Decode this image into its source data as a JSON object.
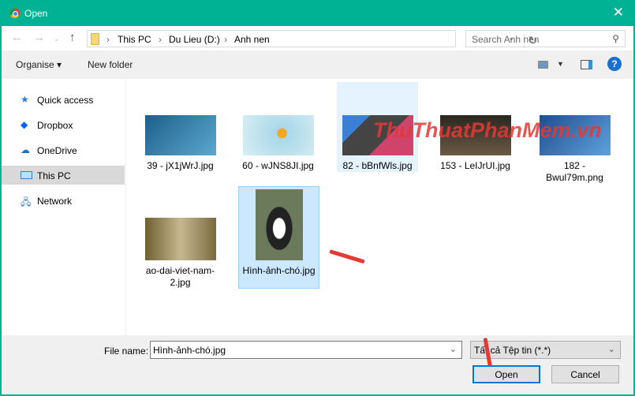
{
  "title": "Open",
  "breadcrumb": [
    "This PC",
    "Du Lieu (D:)",
    "Anh nen"
  ],
  "search_placeholder": "Search Anh nen",
  "toolbar": {
    "organise": "Organise ▾",
    "new_folder": "New folder"
  },
  "sidebar": [
    {
      "label": "Quick access",
      "icon": "star-icon"
    },
    {
      "label": "Dropbox",
      "icon": "dropbox-icon"
    },
    {
      "label": "OneDrive",
      "icon": "cloud-icon"
    },
    {
      "label": "This PC",
      "icon": "computer-icon",
      "selected": true
    },
    {
      "label": "Network",
      "icon": "network-icon"
    }
  ],
  "files": [
    {
      "name": "39 - jX1jWrJ.jpg",
      "color": "#2a6f9a"
    },
    {
      "name": "60 - wJNS8JI.jpg",
      "color": "#9fcfe0"
    },
    {
      "name": "82 - bBnfWls.jpg",
      "color": "#555"
    },
    {
      "name": "153 - LeIJrUI.jpg",
      "color": "#3a3026"
    },
    {
      "name": "182 - Bwul79m.png",
      "color": "#2b6aa8"
    },
    {
      "name": "ao-dai-viet-nam-2.jpg",
      "color": "#8a7a50"
    },
    {
      "name": "Hình-ảnh-chó.jpg",
      "color": "#5a6a50"
    }
  ],
  "watermark": "ThuThuatPhanMem.vn",
  "bottom": {
    "file_name_label": "File name:",
    "file_name": "Hình-ảnh-chó.jpg",
    "file_type": "Tất cả Tệp tin (*.*)",
    "open": "Open",
    "cancel": "Cancel"
  }
}
